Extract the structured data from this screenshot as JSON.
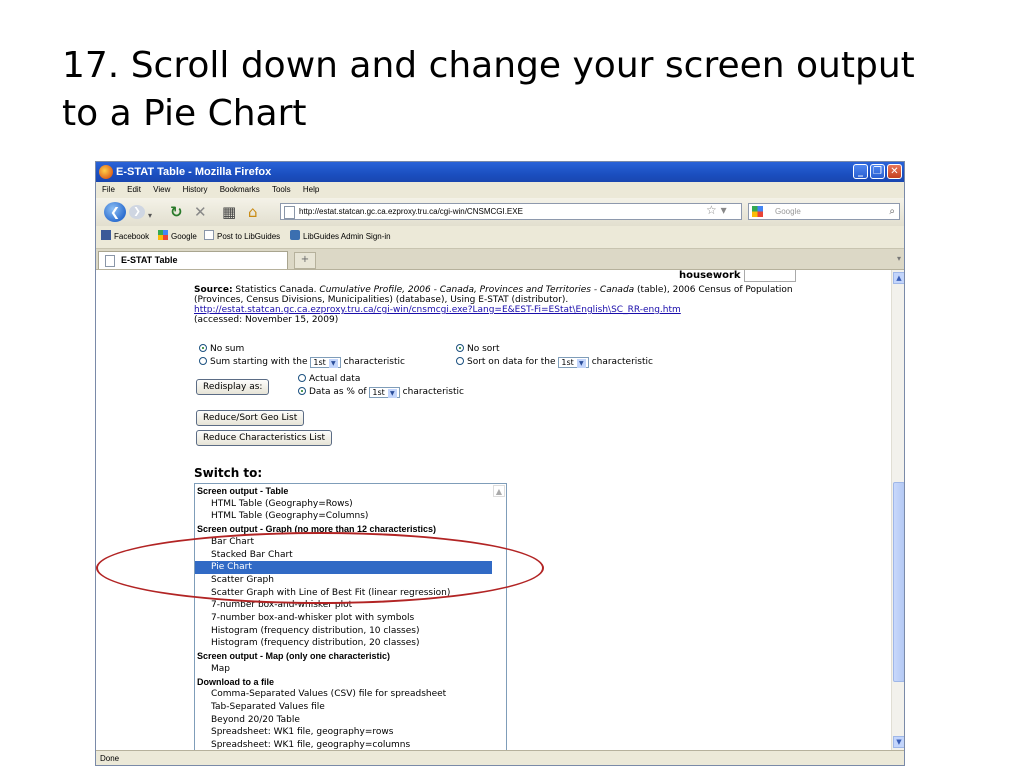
{
  "slide": {
    "title": "17. Scroll down and change your screen output to a Pie Chart"
  },
  "window": {
    "title": "E-STAT Table - Mozilla Firefox"
  },
  "menu": [
    "File",
    "Edit",
    "View",
    "History",
    "Bookmarks",
    "Tools",
    "Help"
  ],
  "address": {
    "url": "http://estat.statcan.gc.ca.ezproxy.tru.ca/cgi-win/CNSMCGI.EXE"
  },
  "search": {
    "placeholder": "Google"
  },
  "bookmarks": [
    "Facebook",
    "Google",
    "Post to LibGuides",
    "LibGuides Admin Sign-in"
  ],
  "tab": {
    "label": "E-STAT Table"
  },
  "content": {
    "housework": "housework",
    "source_label": "Source:",
    "source_text": " Statistics Canada. ",
    "source_italic": "Cumulative Profile, 2006 - Canada, Provinces and Territories - Canada",
    "source_rest": " (table), 2006 Census of Population (Provinces, Census Divisions, Municipalities) (database), Using E-STAT (distributor).",
    "source_link": "http://estat.statcan.gc.ca.ezproxy.tru.ca/cgi-win/cnsmcgi.exe?Lang=E&EST-Fi=EStat\\English\\SC_RR-eng.htm",
    "accessed": "(accessed: November 15, 2009)",
    "no_sum": "No sum",
    "sum_starting": "Sum starting with the",
    "characteristic": "characteristic",
    "no_sort": "No sort",
    "sort_on": "Sort on data for the",
    "select_1st": "1st",
    "redisplay": "Redisplay as:",
    "actual_data": "Actual data",
    "data_as_pct": "Data as % of",
    "reduce_geo": "Reduce/Sort Geo List",
    "reduce_char": "Reduce Characteristics List",
    "switch_to": "Switch to:"
  },
  "output_list": [
    {
      "text": "Screen output - Table",
      "group": true
    },
    {
      "text": "HTML Table (Geography=Rows)"
    },
    {
      "text": "HTML Table (Geography=Columns)"
    },
    {
      "text": "Screen output - Graph (no more than 12 characteristics)",
      "group": true
    },
    {
      "text": "Bar Chart"
    },
    {
      "text": "Stacked Bar Chart"
    },
    {
      "text": "Pie Chart",
      "selected": true
    },
    {
      "text": "Scatter Graph"
    },
    {
      "text": "Scatter Graph with Line of Best Fit (linear regression)"
    },
    {
      "text": "7-number box-and-whisker plot"
    },
    {
      "text": "7-number box-and-whisker plot with symbols"
    },
    {
      "text": "Histogram (frequency distribution, 10 classes)"
    },
    {
      "text": "Histogram (frequency distribution, 20 classes)"
    },
    {
      "text": "Screen output - Map (only one characteristic)",
      "group": true
    },
    {
      "text": "Map"
    },
    {
      "text": "Download to a file",
      "group": true
    },
    {
      "text": "Comma-Separated Values (CSV) file for spreadsheet"
    },
    {
      "text": "Tab-Separated Values file"
    },
    {
      "text": "Beyond 20/20 Table"
    },
    {
      "text": "Spreadsheet: WK1 file, geography=rows"
    },
    {
      "text": "Spreadsheet: WK1 file, geography=columns"
    }
  ],
  "status": {
    "text": "Done"
  },
  "colors": {
    "selection": "#316ac5",
    "annotation": "#b22424",
    "titlebar": "#1b4fc0"
  }
}
